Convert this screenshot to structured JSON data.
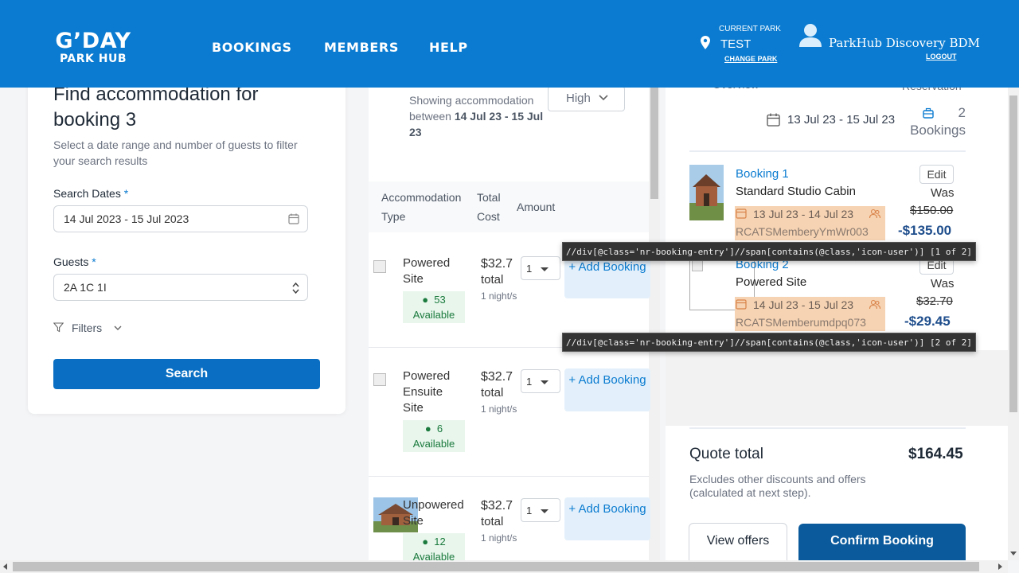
{
  "header": {
    "logo_line1": "G’DAY",
    "logo_line2": "PARK HUB",
    "nav": [
      "BOOKINGS",
      "MEMBERS",
      "HELP"
    ],
    "current_park_label": "CURRENT PARK",
    "current_park": "TEST",
    "change_park": "CHANGE PARK",
    "user_name": "ParkHub Discovery BDM",
    "logout": "LOGOUT"
  },
  "search": {
    "title": "Find accommodation for booking 3",
    "subtitle": "Select a date range and number of guests to filter your search results",
    "dates_label": "Search Dates",
    "dates_value": "14 Jul 2023 - 15 Jul 2023",
    "guests_label": "Guests",
    "guests_value": "2A 1C 1I",
    "required_mark": "*",
    "filters": "Filters",
    "search_button": "Search"
  },
  "results": {
    "showing_prefix": "Showing accommodation between",
    "showing_dates": "14 Jul 23 - 15 Jul 23",
    "sort_value": "High",
    "columns": [
      "Accommodation Type",
      "Total Cost",
      "Amount"
    ],
    "rows": [
      {
        "name": "Powered Site",
        "available": "53",
        "available_label": "Available",
        "price": "$32.7",
        "total": "total",
        "nights": "1 night/s",
        "qty": "1",
        "add": "+ Add Booking"
      },
      {
        "name": "Powered Ensuite Site",
        "available": "6",
        "available_label": "Available",
        "price": "$32.7",
        "total": "total",
        "nights": "1 night/s",
        "qty": "1",
        "add": "+ Add Booking"
      },
      {
        "name": "Unpowered Site",
        "available": "12",
        "available_label": "Available",
        "price": "$32.7",
        "total": "total",
        "nights": "1 night/s",
        "qty": "1",
        "add": "+ Add Booking"
      }
    ]
  },
  "summary": {
    "overview_label": "Overview",
    "reservation_label": "Reservation",
    "dates": "13 Jul 23 - 15 Jul 23",
    "booking_count": "2",
    "bookings_label": "Bookings",
    "bookings": [
      {
        "title": "Booking 1",
        "type": "Standard Studio Cabin",
        "dates": "13 Jul 23 - 14 Jul 23",
        "ref": "RCATSMemberyYmWr003",
        "edit": "Edit",
        "was": "Was",
        "old_price": "$150.00",
        "new_price": "$135.00"
      },
      {
        "title": "Booking 2",
        "type": "Powered Site",
        "dates": "14 Jul 23 - 15 Jul 23",
        "ref": "RCATSMemberumdpq073",
        "edit": "Edit",
        "was": "Was",
        "old_price": "$32.70",
        "new_price": "$29.45"
      }
    ],
    "quote_label": "Quote total",
    "quote_amount": "$164.45",
    "quote_note": "Excludes other discounts and offers (calculated at next step).",
    "view_offers": "View offers",
    "confirm": "Confirm Booking"
  },
  "tooltips": [
    "//div[@class='nr-booking-entry']//span[contains(@class,'icon-user')] [1 of 2]",
    "//div[@class='nr-booking-entry']//span[contains(@class,'icon-user')] [2 of 2]"
  ],
  "colors": {
    "brand": "#0a7bd0",
    "available_bg": "#e8f6ec",
    "highlight": "#f6d3b2"
  }
}
